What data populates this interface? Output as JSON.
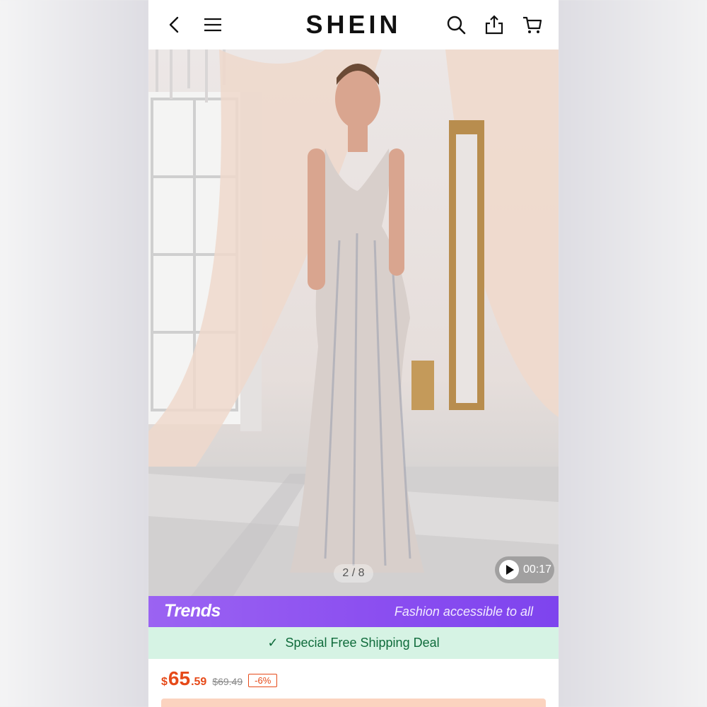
{
  "header": {
    "logo": "SHEIN",
    "icons": [
      "back-arrow-icon",
      "menu-icon",
      "search-icon",
      "share-icon",
      "cart-icon"
    ]
  },
  "gallery": {
    "counter": "2 / 8",
    "video_duration": "00:17"
  },
  "trends": {
    "logo": "Trends",
    "tagline": "Fashion accessible to all",
    "color": "#8a4df0"
  },
  "shipping": {
    "label": "Special Free Shipping Deal",
    "color": "#0f6b3b"
  },
  "price": {
    "currency": "$",
    "integer": "65",
    "decimal": ".59",
    "original": "$69.49",
    "discount": "-6%",
    "color": "#e64a19"
  }
}
